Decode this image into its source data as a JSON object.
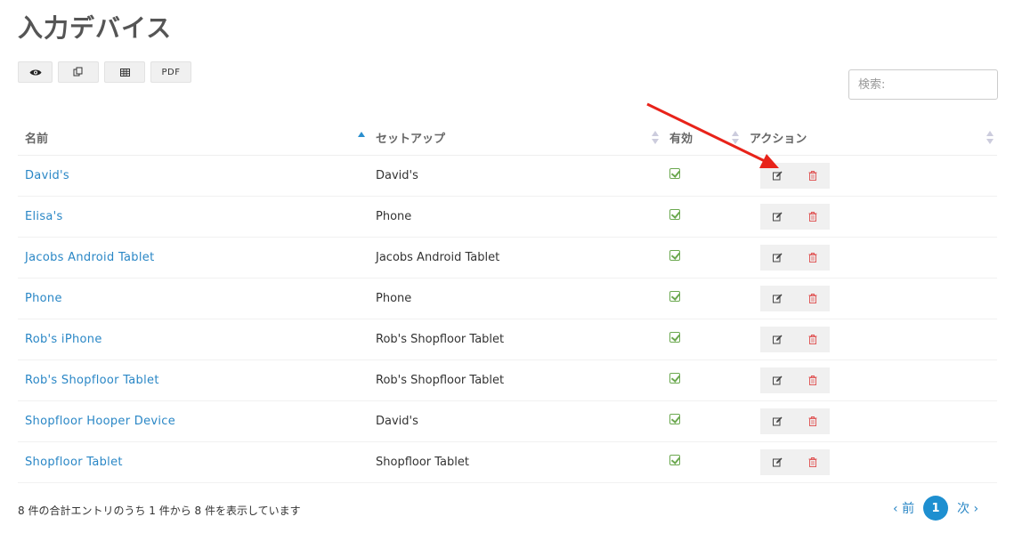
{
  "page": {
    "title": "入力デバイス"
  },
  "toolbar": {
    "view_icon": "eye-icon",
    "copy_icon": "copy-icon",
    "excel_icon": "table-icon",
    "pdf_label": "PDF"
  },
  "search": {
    "placeholder": "検索:"
  },
  "table": {
    "headers": {
      "name": "名前",
      "setup": "セットアップ",
      "active": "有効",
      "action": "アクション"
    },
    "sort": {
      "column": "name",
      "direction": "ascending"
    },
    "rows": [
      {
        "name": "David's",
        "setup": "David's",
        "active": true
      },
      {
        "name": "Elisa's",
        "setup": "Phone",
        "active": true
      },
      {
        "name": "Jacobs Android Tablet",
        "setup": "Jacobs Android Tablet",
        "active": true
      },
      {
        "name": "Phone",
        "setup": "Phone",
        "active": true
      },
      {
        "name": "Rob's iPhone",
        "setup": "Rob's Shopfloor Tablet",
        "active": true
      },
      {
        "name": "Rob's Shopfloor Tablet",
        "setup": "Rob's Shopfloor Tablet",
        "active": true
      },
      {
        "name": "Shopfloor Hooper Device",
        "setup": "David's",
        "active": true
      },
      {
        "name": "Shopfloor Tablet",
        "setup": "Shopfloor Tablet",
        "active": true
      }
    ]
  },
  "footer": {
    "info": "8 件の合計エントリのうち 1 件から 8 件を表示しています",
    "prev": "前",
    "current_page": "1",
    "next": "次"
  },
  "colors": {
    "link": "#2a87c6",
    "check": "#6ba84f",
    "delete": "#e05a5a",
    "annotation_arrow": "#e8231a",
    "page_active": "#1e8fd0"
  }
}
